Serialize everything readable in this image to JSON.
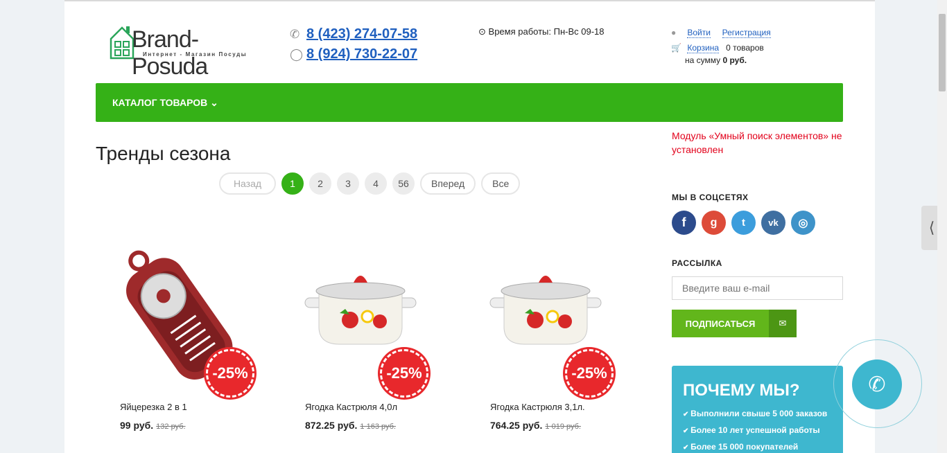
{
  "header": {
    "logo_name": "Brand-Posuda",
    "logo_sub": "Интернет - Магазин Посуды",
    "phone1": "8 (423) 274-07-58",
    "phone2": "8 (924) 730-22-07",
    "hours": "Время работы: Пн-Вс 09-18",
    "login": "Войти",
    "register": "Регистрация",
    "cart": "Корзина",
    "cart_count": "0 товаров",
    "cart_sum_label": "на сумму",
    "cart_sum": "0 руб."
  },
  "menu": {
    "catalog": "КАТАЛОГ ТОВАРОВ"
  },
  "main": {
    "title": "Тренды сезона",
    "pager": {
      "prev": "Назад",
      "pages": [
        "1",
        "2",
        "3",
        "4",
        "56"
      ],
      "next": "Вперед",
      "all": "Все"
    },
    "products": [
      {
        "title": "Яйцерезка 2 в 1",
        "price": "99 руб.",
        "old": "132 руб.",
        "discount": "-25%"
      },
      {
        "title": "Ягодка Кастрюля 4,0л",
        "price": "872.25 руб.",
        "old": "1 163 руб.",
        "discount": "-25%"
      },
      {
        "title": "Ягодка Кастрюля 3,1л.",
        "price": "764.25 руб.",
        "old": "1 019 руб.",
        "discount": "-25%"
      }
    ]
  },
  "sidebar": {
    "warning": "Модуль «Умный поиск элементов» не установлен",
    "social_title": "МЫ В СОЦСЕТЯХ",
    "newsletter_title": "РАССЫЛКА",
    "email_placeholder": "Введите ваш e-mail",
    "subscribe": "ПОДПИСАТЬСЯ",
    "why_title": "ПОЧЕМУ МЫ?",
    "why_items": [
      "Выполнили свыше 5 000 заказов",
      "Более 10 лет успешной работы",
      "Более 15 000 покупателей"
    ]
  },
  "colors": {
    "accent": "#35b117",
    "link": "#1f5fbf",
    "sale": "#e8282c",
    "why_bg": "#3eb7cf"
  },
  "icons": [
    "phone-icon",
    "whatsapp-icon",
    "clock-icon",
    "user-icon",
    "cart-icon",
    "chevron-down-icon",
    "envelope-icon",
    "facebook-icon",
    "google-plus-icon",
    "twitter-icon",
    "vk-icon",
    "instagram-icon",
    "check-icon",
    "call-icon"
  ]
}
